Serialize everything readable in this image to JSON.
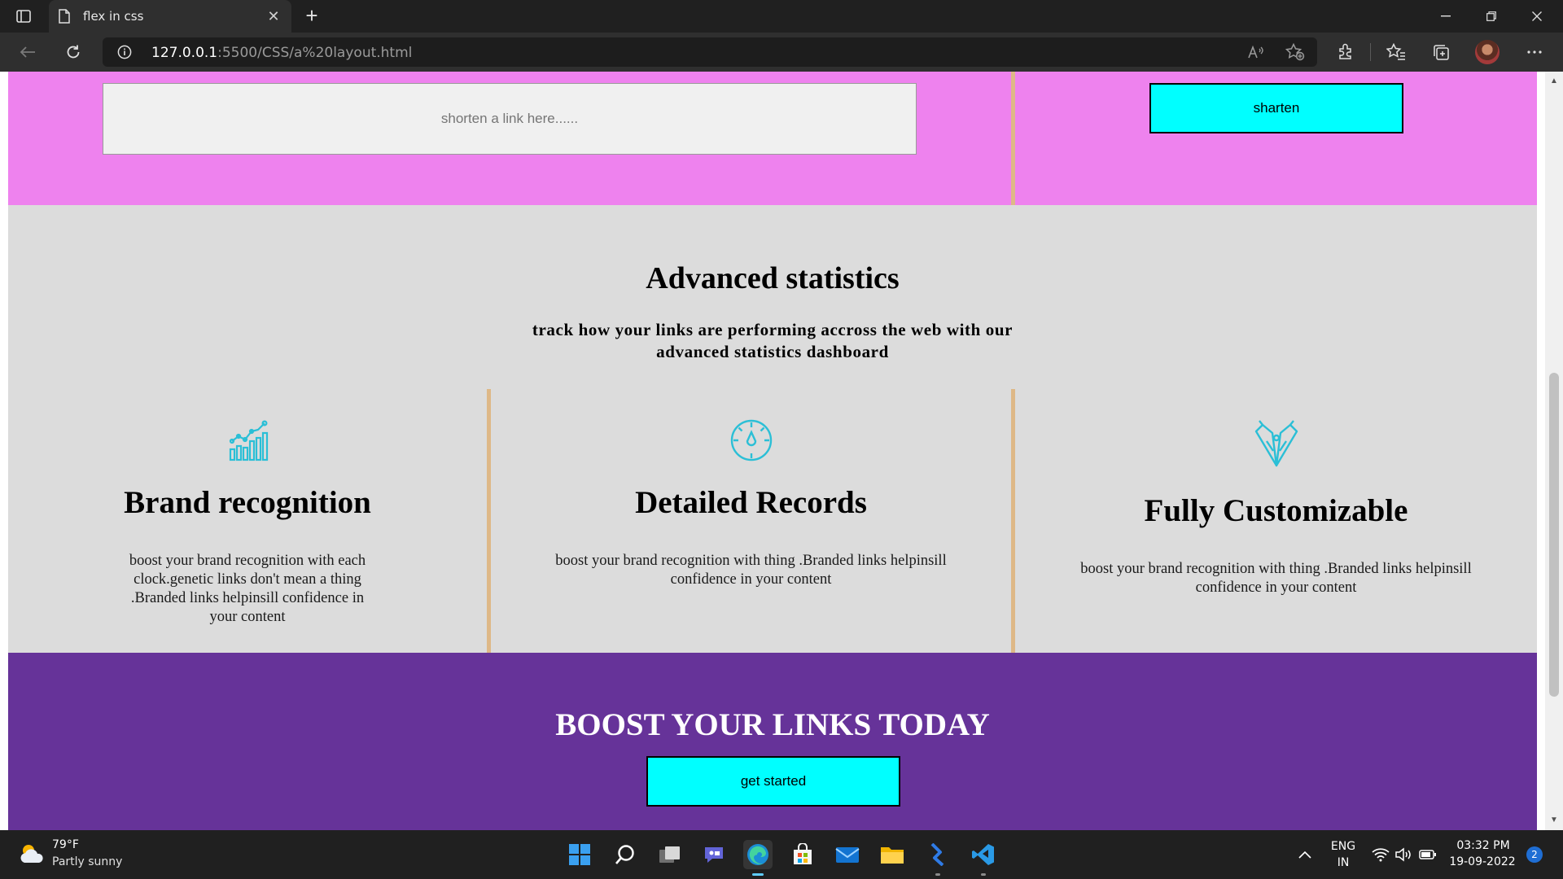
{
  "browser": {
    "tab_title": "flex in css",
    "tab_close": "✕",
    "new_tab": "+",
    "url_host": "127.0.0.1",
    "url_path": ":5500/CSS/a%20layout.html",
    "accent": "#60cdff"
  },
  "page": {
    "shorten": {
      "input_placeholder": "shorten a link here......",
      "button_label": "sharten",
      "bg_color": "#ee82ee",
      "divider_color": "#deb887"
    },
    "stats": {
      "title": "Advanced statistics",
      "subtitle": "track how your links are performing accross the web with our advanced statistics dashboard",
      "bg_color": "#dcdcdc",
      "cards": [
        {
          "icon": "bar-chart-icon",
          "title": "Brand recognition",
          "text": "boost your brand recognition with each clock.genetic links don't mean a thing .Branded links helpinsill confidence in your content"
        },
        {
          "icon": "gauge-icon",
          "title": "Detailed Records",
          "text": "boost your brand recognition with thing .Branded links helpinsill confidence in your content"
        },
        {
          "icon": "brushes-icon",
          "title": "Fully Customizable",
          "text": "boost your brand recognition with thing .Branded links helpinsill confidence in your content"
        }
      ],
      "icon_color": "#2bbfd6"
    },
    "boost": {
      "title": "BOOST YOUR LINKS TODAY",
      "button_label": "get started",
      "bg_color": "#663399",
      "button_color": "#00ffff"
    }
  },
  "taskbar": {
    "weather_temp": "79°F",
    "weather_desc": "Partly sunny",
    "apps": [
      "start-icon",
      "search-icon",
      "task-view-icon",
      "chat-icon",
      "edge-icon",
      "store-icon",
      "mail-icon",
      "file-explorer-icon",
      "power-automate-icon",
      "vscode-icon"
    ],
    "lang_line1": "ENG",
    "lang_line2": "IN",
    "time": "03:32 PM",
    "date": "19-09-2022",
    "notification_count": "2"
  }
}
